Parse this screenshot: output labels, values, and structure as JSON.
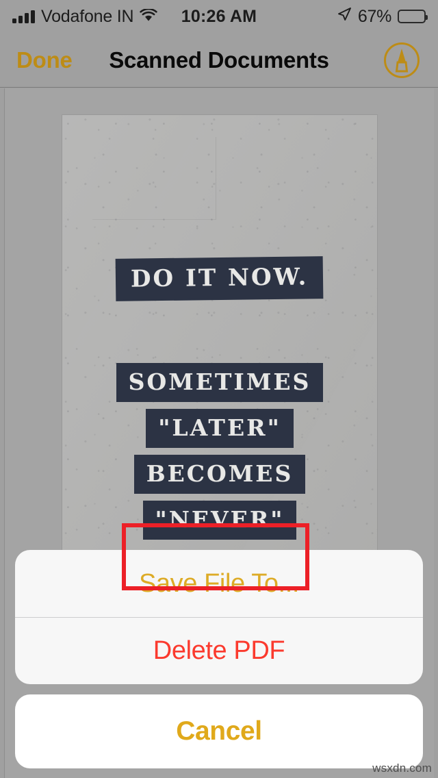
{
  "status_bar": {
    "carrier": "Vodafone IN",
    "signal_bars": 4,
    "wifi_icon": "wifi-icon",
    "time": "10:26 AM",
    "location_icon": "location-arrow-icon",
    "battery_percent": "67%",
    "battery_level": 67
  },
  "nav_bar": {
    "done_label": "Done",
    "title": "Scanned Documents",
    "markup_icon": "markup-pen-icon",
    "accent_color": "#bd8c16"
  },
  "document": {
    "poster_lines": [
      "DO IT NOW.",
      "SOMETIMES",
      "\"LATER\"",
      "BECOMES",
      "\"NEVER\""
    ],
    "banner_bg": "#2c3344",
    "banner_text_color": "#e8e8e6",
    "page_bg": "#b4b4b3"
  },
  "action_sheet": {
    "actions": [
      {
        "label": "Save File To...",
        "style": "default",
        "color": "#ddab26"
      },
      {
        "label": "Delete PDF",
        "style": "destructive",
        "color": "#fb3a2e"
      }
    ],
    "cancel": {
      "label": "Cancel",
      "color": "#e0a91b"
    }
  },
  "annotation": {
    "highlight_color": "#ec2027",
    "highlights_label": "Save File To..."
  },
  "watermark": "wsxdn.com"
}
